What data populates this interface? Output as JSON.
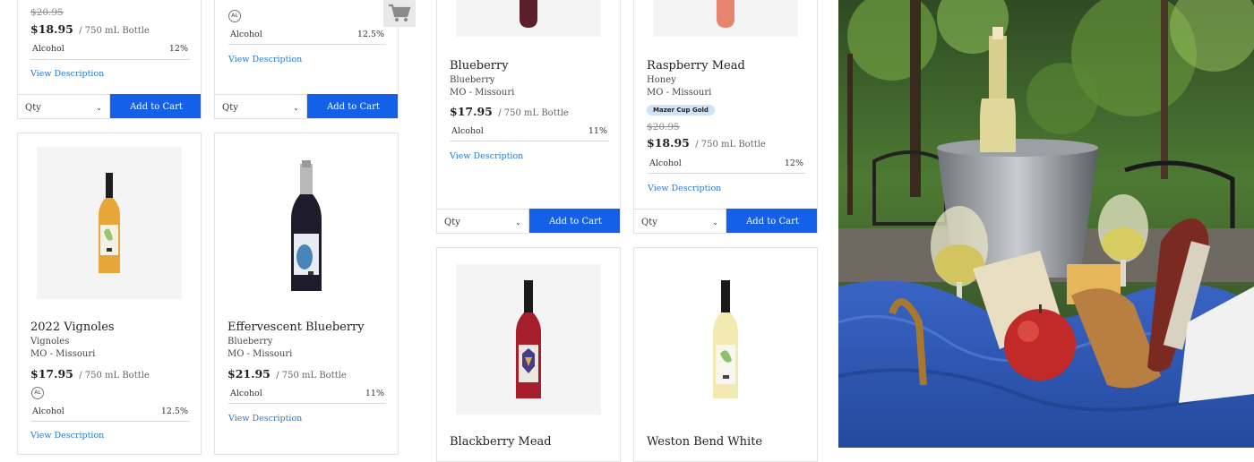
{
  "common": {
    "qty_label": "Qty",
    "add_to_cart": "Add to Cart",
    "view_description": "View Description",
    "alcohol_label": "Alcohol",
    "unit": "/ 750 mL Bottle",
    "al_badge": "AL"
  },
  "col1_top": {
    "old_price": "$20.95",
    "price": "$18.95",
    "alcohol": "12%"
  },
  "col2_top": {
    "alcohol": "12.5%"
  },
  "products": {
    "vignoles": {
      "name": "2022 Vignoles",
      "variety": "Vignoles",
      "region": "MO - Missouri",
      "price": "$17.95",
      "alcohol": "12.5%"
    },
    "effervescent": {
      "name": "Effervescent Blueberry",
      "variety": "Blueberry",
      "region": "MO - Missouri",
      "price": "$21.95",
      "alcohol": "11%"
    },
    "blueberry": {
      "name": "Blueberry",
      "variety": "Blueberry",
      "region": "MO - Missouri",
      "price": "$17.95",
      "alcohol": "11%"
    },
    "raspberry": {
      "name": "Raspberry Mead",
      "variety": "Honey",
      "region": "MO - Missouri",
      "badge": "Mazer Cup Gold",
      "old_price": "$20.95",
      "price": "$18.95",
      "alcohol": "12%"
    },
    "blackberry": {
      "name": "Blackberry Mead"
    },
    "weston": {
      "name": "Weston Bend White"
    }
  },
  "colors": {
    "button_blue": "#1560e8",
    "link_blue": "#2a7bd0",
    "badge_bg": "#cfe3f5"
  }
}
